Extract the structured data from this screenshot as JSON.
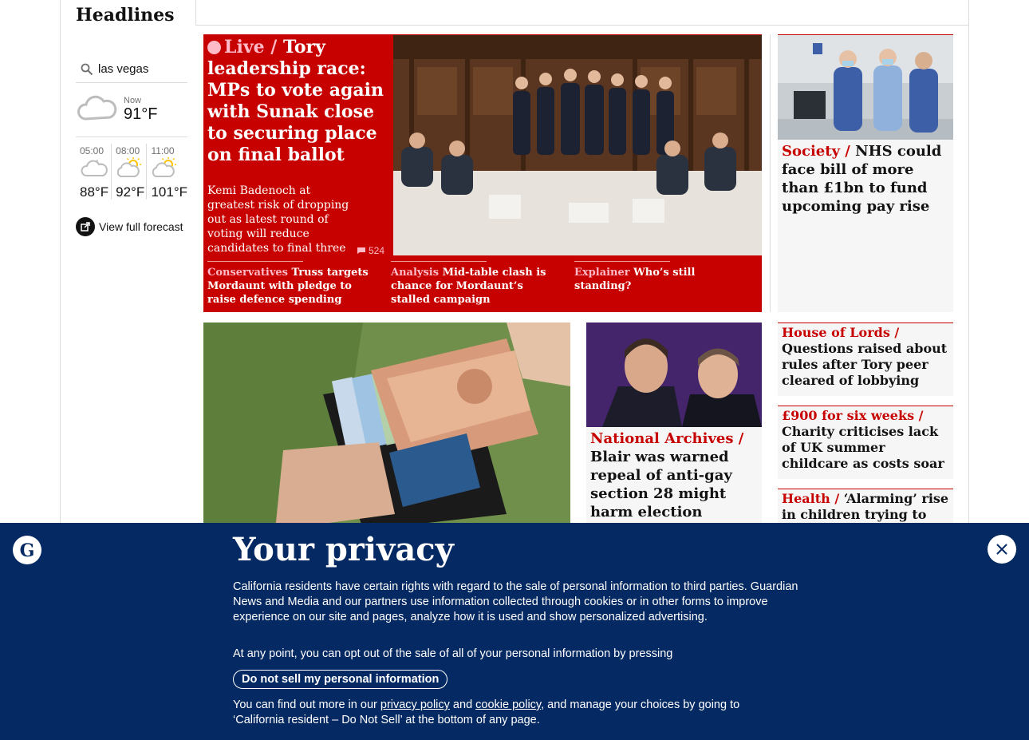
{
  "section": {
    "title": "Headlines"
  },
  "weather": {
    "location": "las vegas",
    "now_label": "Now",
    "now_temp": "91°F",
    "forecast": [
      {
        "time": "05:00",
        "temp": "88°F",
        "icon": "night-cloud-icon"
      },
      {
        "time": "08:00",
        "temp": "92°F",
        "icon": "sun-cloud-icon"
      },
      {
        "time": "11:00",
        "temp": "101°F",
        "icon": "sun-cloud-icon"
      }
    ],
    "full_forecast": "View full forecast"
  },
  "main_story": {
    "kicker": "Live /",
    "headline": "Tory leadership race: MPs to vote again with Sunak close to securing place on final ballot",
    "standfirst": "Kemi Badenoch at greatest risk of dropping out as latest round of voting will reduce candidates to final three",
    "comments": "524",
    "sublinks": [
      {
        "kicker": "Conservatives",
        "text": "Truss targets Mordaunt with pledge to raise defence spending"
      },
      {
        "kicker": "Analysis",
        "text": "Mid-table clash is chance for Mordaunt’s stalled campaign"
      },
      {
        "kicker": "Explainer",
        "text": "Who’s still standing?"
      }
    ]
  },
  "right_story": {
    "kicker": "Society /",
    "headline": "NHS could face bill of more than £1bn to fund upcoming pay rise"
  },
  "small_stories": [
    {
      "kicker": "House of Lords /",
      "headline": "Questions raised about rules after Tory peer cleared of lobbying"
    },
    {
      "kicker": "£900 for six weeks /",
      "headline": "Charity criticises lack of UK summer childcare as costs soar"
    },
    {
      "kicker": "Health /",
      "headline": "‘Alarming’ rise in children trying to lose"
    }
  ],
  "blair_story": {
    "kicker": "National Archives /",
    "headline": "Blair was warned repeal of anti-gay section 28 might harm election chances"
  },
  "privacy": {
    "title": "Your privacy",
    "p1": "California residents have certain rights with regard to the sale of personal information to third parties. Guardian News and Media and our partners use information collected through cookies or in other forms to improve experience on our site and pages, analyze how it is used and show personalized advertising.",
    "p2": "At any point, you can opt out of the sale of all of your personal information by pressing",
    "button": "Do not sell my personal information",
    "p3_a": "You can find out more in our ",
    "privacy_link": "privacy policy",
    "p3_and": " and ",
    "cookie_link": "cookie policy",
    "p3_b": ", and manage your choices by going to ‘California resident – Do Not Sell’ at the bottom of any page."
  },
  "colors": {
    "brand_red": "#c70000",
    "banner_blue": "#052962",
    "live_pink": "#ffbac8"
  }
}
